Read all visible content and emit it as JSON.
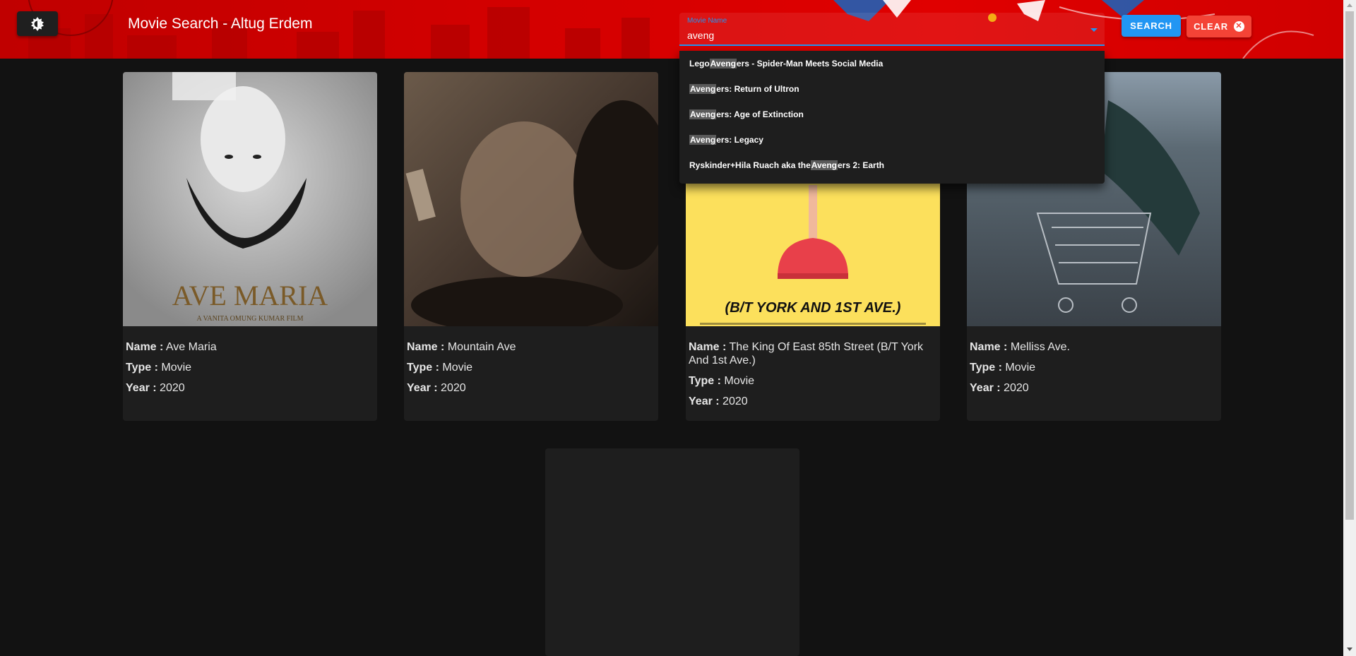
{
  "header": {
    "title": "Movie Search - Altug Erdem",
    "theme_toggle_icon": "brightness-icon",
    "accent_color": "#d40000"
  },
  "search": {
    "label": "Movie Name",
    "value": "aveng",
    "search_label": "SEARCH",
    "clear_label": "CLEAR",
    "clear_icon": "close-circle-icon"
  },
  "suggestions": [
    {
      "pre": "Lego ",
      "match": "Aveng",
      "post": "ers - Spider-Man Meets Social Media"
    },
    {
      "pre": "",
      "match": "Aveng",
      "post": "ers: Return of Ultron"
    },
    {
      "pre": "",
      "match": "Aveng",
      "post": "ers: Age of Extinction"
    },
    {
      "pre": "",
      "match": "Aveng",
      "post": "ers: Legacy"
    },
    {
      "pre": "Ryskinder+Hila Ruach aka the ",
      "match": "Aveng",
      "post": "ers 2: Earth"
    }
  ],
  "cards": [
    {
      "name_label": "Name :",
      "name": "Ave Maria",
      "type_label": "Type :",
      "type": "Movie",
      "year_label": "Year :",
      "year": "2020",
      "poster_title": "AVE MARIA",
      "poster_sub": "A VANITA OMUNG KUMAR FILM"
    },
    {
      "name_label": "Name :",
      "name": "Mountain Ave",
      "type_label": "Type :",
      "type": "Movie",
      "year_label": "Year :",
      "year": "2020"
    },
    {
      "name_label": "Name :",
      "name": "The King Of East 85th Street (B/T York And 1st Ave.)",
      "type_label": "Type :",
      "type": "Movie",
      "year_label": "Year :",
      "year": "2020",
      "poster_title": "(B/T YORK AND 1ST AVE.)"
    },
    {
      "name_label": "Name :",
      "name": "Melliss Ave.",
      "type_label": "Type :",
      "type": "Movie",
      "year_label": "Year :",
      "year": "2020"
    }
  ]
}
